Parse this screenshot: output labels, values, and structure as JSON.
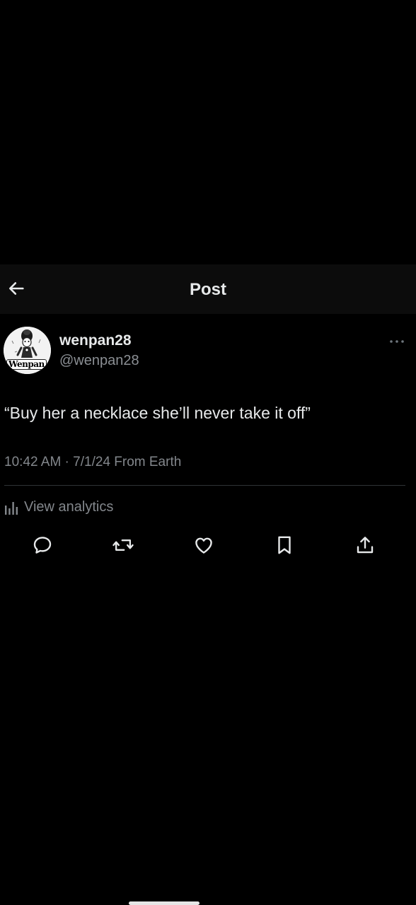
{
  "header": {
    "title": "Post",
    "back_icon": "arrow-left-icon"
  },
  "post": {
    "author": {
      "display_name": "wenpan28",
      "handle": "@wenpan28",
      "avatar_label": "Wenpan"
    },
    "more_icon": "more-horizontal-icon",
    "text": "“Buy her a necklace she’ll never take it off”",
    "timestamp": "10:42 AM · 7/1/24 From Earth",
    "analytics_label": "View analytics",
    "analytics_icon": "bar-chart-icon"
  },
  "actions": [
    {
      "name": "reply",
      "icon": "comment-icon"
    },
    {
      "name": "repost",
      "icon": "repost-icon"
    },
    {
      "name": "like",
      "icon": "heart-icon"
    },
    {
      "name": "bookmark",
      "icon": "bookmark-icon"
    },
    {
      "name": "share",
      "icon": "share-icon"
    }
  ],
  "colors": {
    "background": "#000000",
    "header_background": "#0c0c0c",
    "primary_text": "#e7e9ea",
    "secondary_text": "#83878c",
    "divider": "#2f3336"
  }
}
